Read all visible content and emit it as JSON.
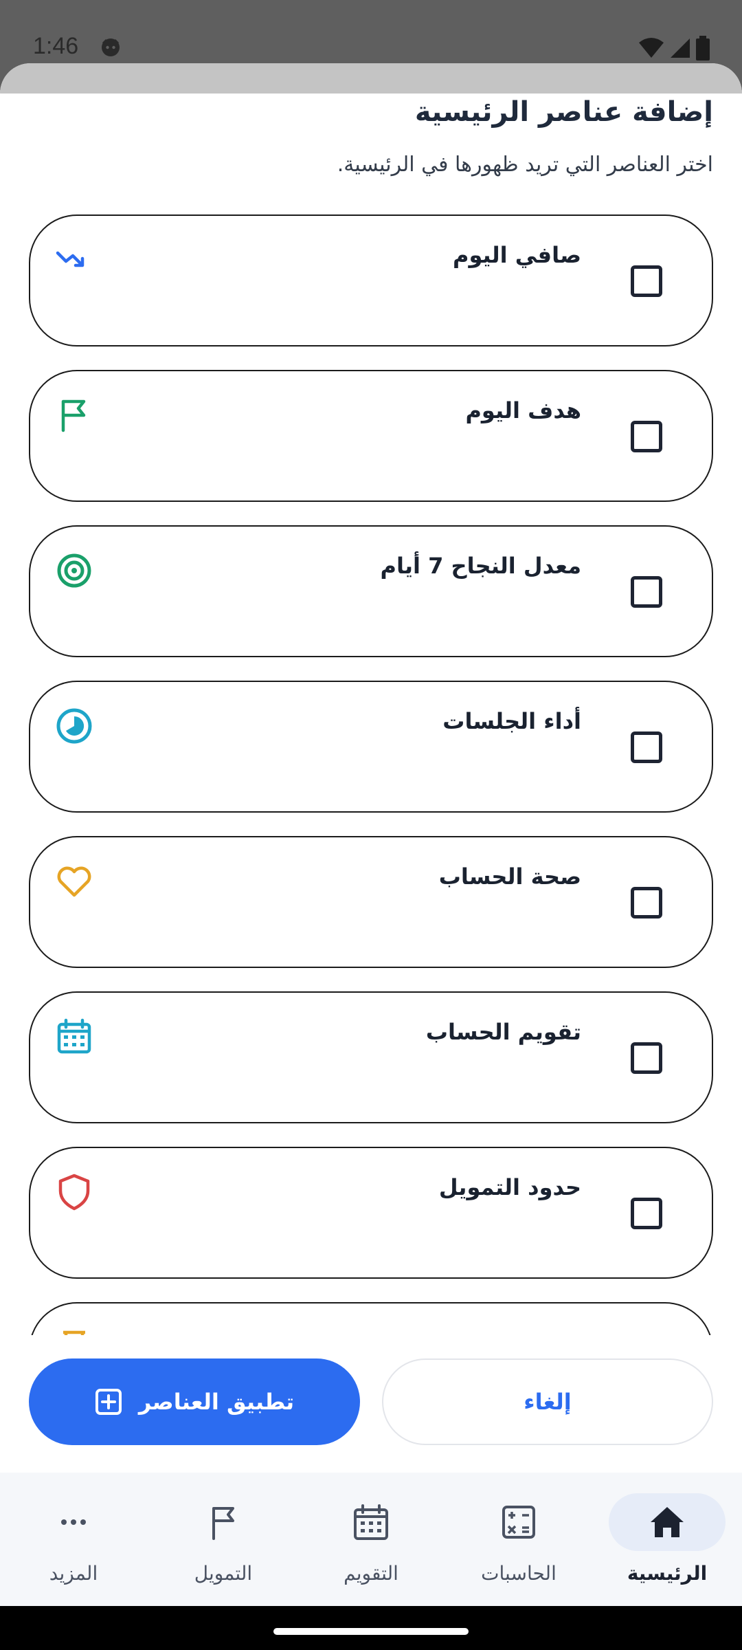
{
  "status_bar": {
    "time": "1:46"
  },
  "sheet": {
    "title": "إضافة عناصر الرئيسية",
    "subtitle": "اختر العناصر التي تريد ظهورها في الرئيسية."
  },
  "items": [
    {
      "label": "صافي اليوم",
      "icon": "trend-down-icon",
      "icon_color": "#2c6cf0",
      "checked": false
    },
    {
      "label": "هدف اليوم",
      "icon": "flag-icon",
      "icon_color": "#1aa06a",
      "checked": false
    },
    {
      "label": "معدل النجاح 7 أيام",
      "icon": "target-icon",
      "icon_color": "#1aa06a",
      "checked": false
    },
    {
      "label": "أداء الجلسات",
      "icon": "pie-clock-icon",
      "icon_color": "#1ea5c9",
      "checked": false
    },
    {
      "label": "صحة الحساب",
      "icon": "heart-icon",
      "icon_color": "#e6a425",
      "checked": false
    },
    {
      "label": "تقويم الحساب",
      "icon": "calendar-icon",
      "icon_color": "#1ea5c9",
      "checked": false
    },
    {
      "label": "حدود التمويل",
      "icon": "shield-icon",
      "icon_color": "#d94444",
      "checked": false
    }
  ],
  "actions": {
    "apply_label": "تطبيق العناصر",
    "cancel_label": "إلغاء"
  },
  "nav": [
    {
      "label": "الرئيسية",
      "icon": "home-icon",
      "active": true
    },
    {
      "label": "الحاسبات",
      "icon": "calculator-icon",
      "active": false
    },
    {
      "label": "التقويم",
      "icon": "calendar-icon",
      "active": false
    },
    {
      "label": "التمويل",
      "icon": "flag-icon",
      "active": false
    },
    {
      "label": "المزيد",
      "icon": "more-icon",
      "active": false
    }
  ],
  "colors": {
    "accent": "#2c6cf0",
    "nav_active_bg": "#e6ecf8"
  }
}
